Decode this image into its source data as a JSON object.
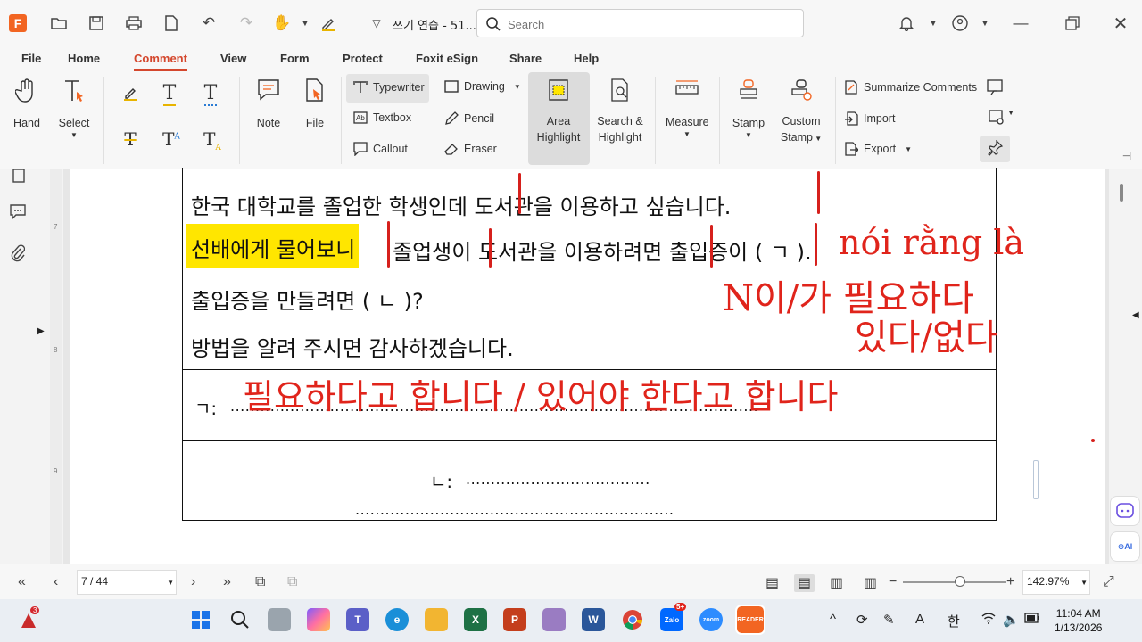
{
  "app": {
    "doc_title": "쓰기 연습 - 51...",
    "search_placeholder": "Search"
  },
  "menu": {
    "tabs": [
      "File",
      "Home",
      "Comment",
      "View",
      "Form",
      "Protect",
      "Foxit eSign",
      "Share",
      "Help"
    ],
    "active": "Comment"
  },
  "ribbon": {
    "hand": "Hand",
    "select": "Select",
    "note": "Note",
    "file": "File",
    "typewriter": "Typewriter",
    "textbox": "Textbox",
    "callout": "Callout",
    "drawing": "Drawing",
    "pencil": "Pencil",
    "eraser": "Eraser",
    "area_highlight_1": "Area",
    "area_highlight_2": "Highlight",
    "search_highlight_1": "Search &",
    "search_highlight_2": "Highlight",
    "measure": "Measure",
    "stamp": "Stamp",
    "custom_stamp_1": "Custom",
    "custom_stamp_2": "Stamp",
    "summarize": "Summarize Comments",
    "import": "Import",
    "export": "Export"
  },
  "ruler": [
    "7",
    "8",
    "9"
  ],
  "document": {
    "line1": "한국 대학교를 졸업한 학생인데 도서관을 이용하고 싶습니다.",
    "line2_highlight": "선배에게 물어보니",
    "line2_rest": "졸업생이 도서관을 이용하려면 출입증이 (        ㄱ          ).",
    "line3": "출입증을 만들려면 (          ㄴ            )?",
    "line4": "방법을 알려 주시면 감사하겠습니다.",
    "answer_a_label": "ㄱ:",
    "answer_b_label": "ㄴ:",
    "handwriting": {
      "note1": "nói rằng là",
      "note2": "N이/가 필요하다",
      "note3": "있다/없다",
      "answer_a": "필요하다고 합니다 / 있어야 한다고 합니다"
    }
  },
  "status": {
    "page": "7 / 44",
    "zoom": "142.97%"
  },
  "taskbar": {
    "notif_badge": "3",
    "zalo_badge": "5+",
    "time": "11:04 AM",
    "date": "1/13/2026",
    "ime": "한",
    "lang": "A"
  }
}
